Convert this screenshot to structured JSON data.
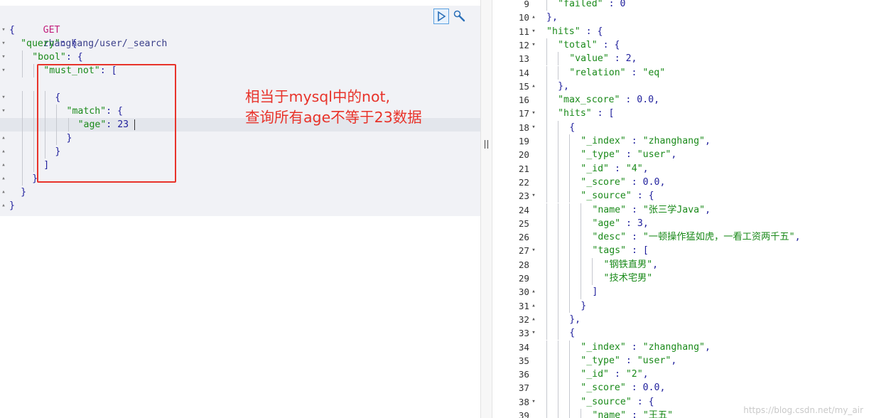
{
  "request": {
    "method": "GET",
    "path": "zhanghang/user/_search",
    "lines": [
      {
        "indent": 0,
        "fold": "▾",
        "parts": [
          [
            "k",
            "{"
          ]
        ]
      },
      {
        "indent": 1,
        "fold": "▾",
        "parts": [
          [
            "s",
            "\"query\""
          ],
          [
            "k",
            ": {"
          ]
        ]
      },
      {
        "indent": 2,
        "fold": "▾",
        "parts": [
          [
            "s",
            "\"bool\""
          ],
          [
            "k",
            ": {"
          ]
        ]
      },
      {
        "indent": 3,
        "fold": "▾",
        "parts": [
          [
            "s",
            "\"must_not\""
          ],
          [
            "k",
            ": ["
          ]
        ]
      },
      {
        "indent": 0,
        "fold": "",
        "parts": []
      },
      {
        "indent": 4,
        "fold": "▾",
        "parts": [
          [
            "k",
            "{"
          ]
        ]
      },
      {
        "indent": 5,
        "fold": "▾",
        "parts": [
          [
            "s",
            "\"match\""
          ],
          [
            "k",
            ": {"
          ]
        ]
      },
      {
        "indent": 6,
        "fold": "",
        "parts": [
          [
            "s",
            "\"age\""
          ],
          [
            "k",
            ": "
          ],
          [
            "n",
            "23"
          ]
        ],
        "active": true
      },
      {
        "indent": 5,
        "fold": "▴",
        "parts": [
          [
            "k",
            "}"
          ]
        ]
      },
      {
        "indent": 4,
        "fold": "▴",
        "parts": [
          [
            "k",
            "}"
          ]
        ]
      },
      {
        "indent": 3,
        "fold": "▴",
        "parts": [
          [
            "k",
            "]"
          ]
        ]
      },
      {
        "indent": 2,
        "fold": "▴",
        "parts": [
          [
            "k",
            "}"
          ]
        ]
      },
      {
        "indent": 1,
        "fold": "▴",
        "parts": [
          [
            "k",
            "}"
          ]
        ]
      },
      {
        "indent": 0,
        "fold": "▴",
        "parts": [
          [
            "k",
            "}"
          ]
        ]
      }
    ],
    "run_icon": "play-icon",
    "settings_icon": "wrench-icon"
  },
  "annotation": {
    "text": "相当于mysql中的not,\n查询所有age不等于23数据",
    "color": "#e8332a"
  },
  "response": {
    "lines": [
      {
        "no": "9",
        "fold": "",
        "indent": 2,
        "parts": [
          [
            "s",
            "\"failed\""
          ],
          [
            "k",
            " : "
          ],
          [
            "n",
            "0"
          ]
        ]
      },
      {
        "no": "10",
        "fold": "▴",
        "indent": 1,
        "parts": [
          [
            "k",
            "},"
          ]
        ]
      },
      {
        "no": "11",
        "fold": "▾",
        "indent": 1,
        "parts": [
          [
            "s",
            "\"hits\""
          ],
          [
            "k",
            " : {"
          ]
        ]
      },
      {
        "no": "12",
        "fold": "▾",
        "indent": 2,
        "parts": [
          [
            "s",
            "\"total\""
          ],
          [
            "k",
            " : {"
          ]
        ]
      },
      {
        "no": "13",
        "fold": "",
        "indent": 3,
        "parts": [
          [
            "s",
            "\"value\""
          ],
          [
            "k",
            " : "
          ],
          [
            "n",
            "2"
          ],
          [
            "k",
            ","
          ]
        ]
      },
      {
        "no": "14",
        "fold": "",
        "indent": 3,
        "parts": [
          [
            "s",
            "\"relation\""
          ],
          [
            "k",
            " : "
          ],
          [
            "s",
            "\"eq\""
          ]
        ]
      },
      {
        "no": "15",
        "fold": "▴",
        "indent": 2,
        "parts": [
          [
            "k",
            "},"
          ]
        ]
      },
      {
        "no": "16",
        "fold": "",
        "indent": 2,
        "parts": [
          [
            "s",
            "\"max_score\""
          ],
          [
            "k",
            " : "
          ],
          [
            "n",
            "0.0"
          ],
          [
            "k",
            ","
          ]
        ]
      },
      {
        "no": "17",
        "fold": "▾",
        "indent": 2,
        "parts": [
          [
            "s",
            "\"hits\""
          ],
          [
            "k",
            " : ["
          ]
        ]
      },
      {
        "no": "18",
        "fold": "▾",
        "indent": 3,
        "parts": [
          [
            "k",
            "{"
          ]
        ]
      },
      {
        "no": "19",
        "fold": "",
        "indent": 4,
        "parts": [
          [
            "s",
            "\"_index\""
          ],
          [
            "k",
            " : "
          ],
          [
            "s",
            "\"zhanghang\""
          ],
          [
            "k",
            ","
          ]
        ]
      },
      {
        "no": "20",
        "fold": "",
        "indent": 4,
        "parts": [
          [
            "s",
            "\"_type\""
          ],
          [
            "k",
            " : "
          ],
          [
            "s",
            "\"user\""
          ],
          [
            "k",
            ","
          ]
        ]
      },
      {
        "no": "21",
        "fold": "",
        "indent": 4,
        "parts": [
          [
            "s",
            "\"_id\""
          ],
          [
            "k",
            " : "
          ],
          [
            "s",
            "\"4\""
          ],
          [
            "k",
            ","
          ]
        ]
      },
      {
        "no": "22",
        "fold": "",
        "indent": 4,
        "parts": [
          [
            "s",
            "\"_score\""
          ],
          [
            "k",
            " : "
          ],
          [
            "n",
            "0.0"
          ],
          [
            "k",
            ","
          ]
        ]
      },
      {
        "no": "23",
        "fold": "▾",
        "indent": 4,
        "parts": [
          [
            "s",
            "\"_source\""
          ],
          [
            "k",
            " : {"
          ]
        ]
      },
      {
        "no": "24",
        "fold": "",
        "indent": 5,
        "parts": [
          [
            "s",
            "\"name\""
          ],
          [
            "k",
            " : "
          ],
          [
            "s",
            "\"张三学Java\""
          ],
          [
            "k",
            ","
          ]
        ]
      },
      {
        "no": "25",
        "fold": "",
        "indent": 5,
        "parts": [
          [
            "s",
            "\"age\""
          ],
          [
            "k",
            " : "
          ],
          [
            "n",
            "3"
          ],
          [
            "k",
            ","
          ]
        ]
      },
      {
        "no": "26",
        "fold": "",
        "indent": 5,
        "parts": [
          [
            "s",
            "\"desc\""
          ],
          [
            "k",
            " : "
          ],
          [
            "s",
            "\"一顿操作猛如虎，一看工资两千五\""
          ],
          [
            "k",
            ","
          ]
        ]
      },
      {
        "no": "27",
        "fold": "▾",
        "indent": 5,
        "parts": [
          [
            "s",
            "\"tags\""
          ],
          [
            "k",
            " : ["
          ]
        ]
      },
      {
        "no": "28",
        "fold": "",
        "indent": 6,
        "parts": [
          [
            "s",
            "\"钢铁直男\""
          ],
          [
            "k",
            ","
          ]
        ]
      },
      {
        "no": "29",
        "fold": "",
        "indent": 6,
        "parts": [
          [
            "s",
            "\"技术宅男\""
          ]
        ]
      },
      {
        "no": "30",
        "fold": "▴",
        "indent": 5,
        "parts": [
          [
            "k",
            "]"
          ]
        ]
      },
      {
        "no": "31",
        "fold": "▴",
        "indent": 4,
        "parts": [
          [
            "k",
            "}"
          ]
        ]
      },
      {
        "no": "32",
        "fold": "▴",
        "indent": 3,
        "parts": [
          [
            "k",
            "},"
          ]
        ]
      },
      {
        "no": "33",
        "fold": "▾",
        "indent": 3,
        "parts": [
          [
            "k",
            "{"
          ]
        ]
      },
      {
        "no": "34",
        "fold": "",
        "indent": 4,
        "parts": [
          [
            "s",
            "\"_index\""
          ],
          [
            "k",
            " : "
          ],
          [
            "s",
            "\"zhanghang\""
          ],
          [
            "k",
            ","
          ]
        ]
      },
      {
        "no": "35",
        "fold": "",
        "indent": 4,
        "parts": [
          [
            "s",
            "\"_type\""
          ],
          [
            "k",
            " : "
          ],
          [
            "s",
            "\"user\""
          ],
          [
            "k",
            ","
          ]
        ]
      },
      {
        "no": "36",
        "fold": "",
        "indent": 4,
        "parts": [
          [
            "s",
            "\"_id\""
          ],
          [
            "k",
            " : "
          ],
          [
            "s",
            "\"2\""
          ],
          [
            "k",
            ","
          ]
        ]
      },
      {
        "no": "37",
        "fold": "",
        "indent": 4,
        "parts": [
          [
            "s",
            "\"_score\""
          ],
          [
            "k",
            " : "
          ],
          [
            "n",
            "0.0"
          ],
          [
            "k",
            ","
          ]
        ]
      },
      {
        "no": "38",
        "fold": "▾",
        "indent": 4,
        "parts": [
          [
            "s",
            "\"_source\""
          ],
          [
            "k",
            " : {"
          ]
        ]
      },
      {
        "no": "39",
        "fold": "",
        "indent": 5,
        "parts": [
          [
            "s",
            "\"name\""
          ],
          [
            "k",
            " : "
          ],
          [
            "s",
            "\"王五\""
          ]
        ]
      }
    ]
  },
  "watermark": "https://blog.csdn.net/my_air"
}
